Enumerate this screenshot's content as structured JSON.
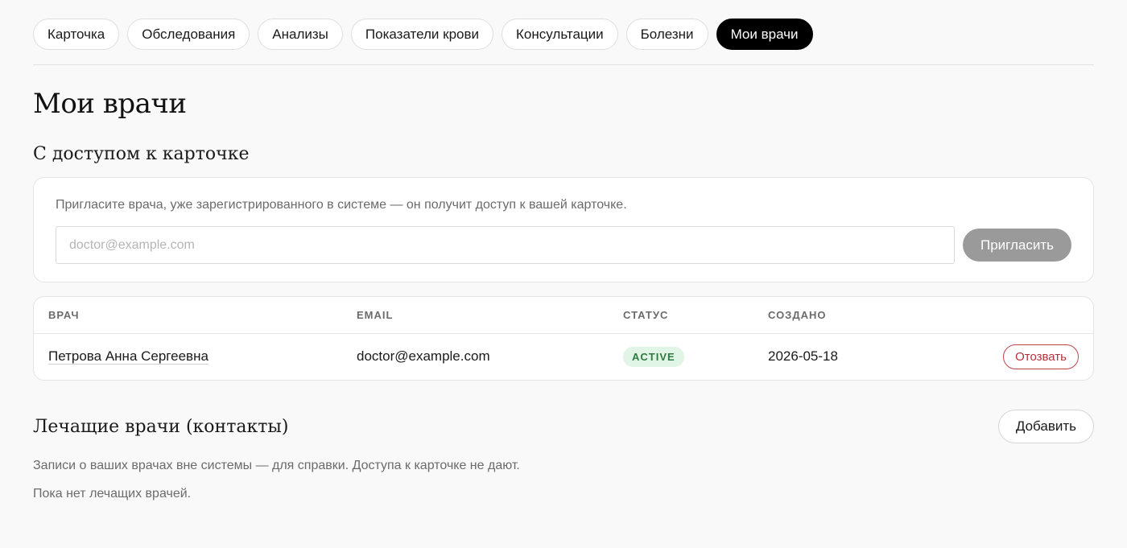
{
  "tabs": [
    {
      "label": "Карточка",
      "active": false
    },
    {
      "label": "Обследования",
      "active": false
    },
    {
      "label": "Анализы",
      "active": false
    },
    {
      "label": "Показатели крови",
      "active": false
    },
    {
      "label": "Консультации",
      "active": false
    },
    {
      "label": "Болезни",
      "active": false
    },
    {
      "label": "Мои врачи",
      "active": true
    }
  ],
  "page": {
    "title": "Мои врачи"
  },
  "access_section": {
    "title": "С доступом к карточке",
    "invite_hint": "Пригласите врача, уже зарегистрированного в системе — он получит доступ к вашей карточке.",
    "invite_input": {
      "placeholder": "doctor@example.com",
      "value": ""
    },
    "invite_button": "Пригласить",
    "table": {
      "headers": {
        "doctor": "ВРАЧ",
        "email": "EMAIL",
        "status": "СТАТУС",
        "created": "СОЗДАНО"
      },
      "rows": [
        {
          "doctor": "Петрова Анна Сергеевна",
          "email": "doctor@example.com",
          "status": "ACTIVE",
          "created": "2026-05-18",
          "action": "Отозвать"
        }
      ]
    }
  },
  "treating_section": {
    "title": "Лечащие врачи (контакты)",
    "add_button": "Добавить",
    "description": "Записи о ваших врачах вне системы — для справки. Доступа к карточке не дают.",
    "empty_text": "Пока нет лечащих врачей."
  },
  "colors": {
    "active_tab_bg": "#000000",
    "status_active_bg": "#e1f5e6",
    "status_active_text": "#2f7a43",
    "revoke": "#b3323b",
    "invite_button_bg": "#9a9a9a"
  }
}
